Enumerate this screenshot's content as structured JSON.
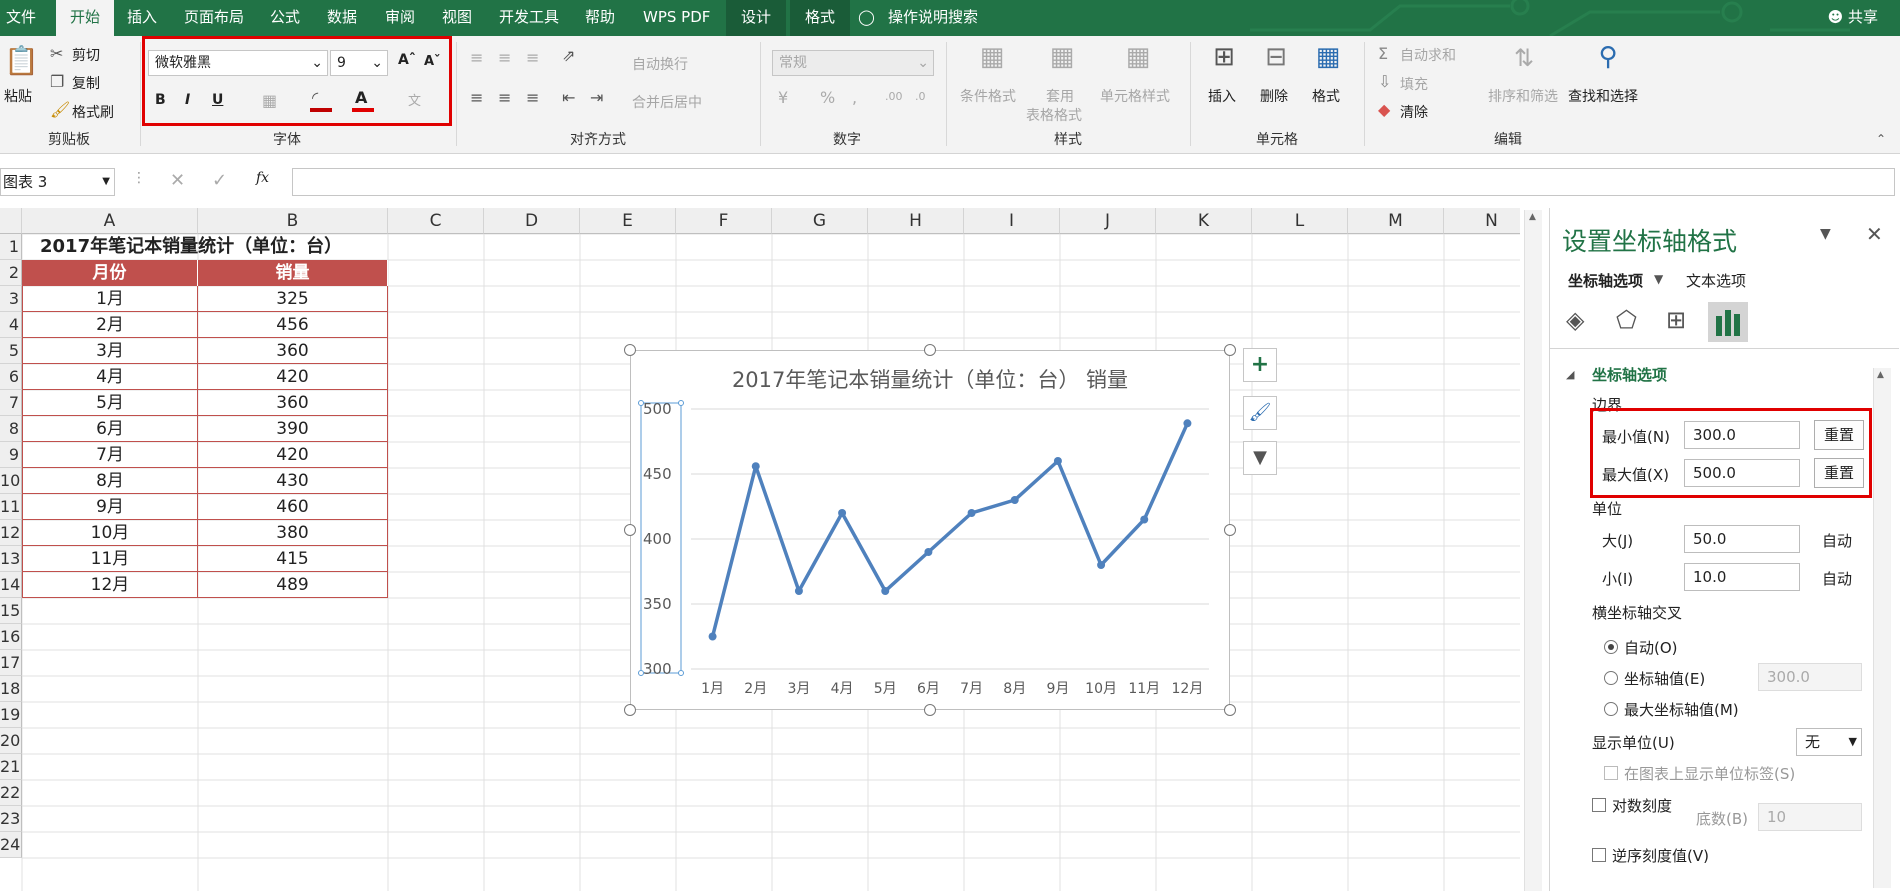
{
  "menu": {
    "tabs": [
      "文件",
      "开始",
      "插入",
      "页面布局",
      "公式",
      "数据",
      "审阅",
      "视图",
      "开发工具",
      "帮助",
      "WPS PDF",
      "设计",
      "格式"
    ],
    "active_tab": "开始",
    "search_label": "操作说明搜索",
    "share_label": "共享"
  },
  "ribbon": {
    "clipboard": {
      "paste": "粘贴",
      "cut": "剪切",
      "copy": "复制",
      "format_painter": "格式刷",
      "label": "剪贴板"
    },
    "font": {
      "family": "微软雅黑",
      "size": "9",
      "bold": "B",
      "italic": "I",
      "underline": "U",
      "label": "字体"
    },
    "alignment": {
      "wrap_text": "自动换行",
      "merge_center": "合并后居中",
      "label": "对齐方式"
    },
    "number": {
      "format": "常规",
      "label": "数字"
    },
    "styles": {
      "conditional": "条件格式",
      "table_line1": "套用",
      "table_line2": "表格格式",
      "cell_styles": "单元格样式",
      "label": "样式"
    },
    "cells": {
      "insert": "插入",
      "delete": "删除",
      "format": "格式",
      "label": "单元格"
    },
    "editing": {
      "autosum": "自动求和",
      "fill": "填充",
      "clear": "清除",
      "sort_filter": "排序和筛选",
      "find_select": "查找和选择",
      "label": "编辑"
    }
  },
  "formula_bar": {
    "name_box": "图表 3",
    "fx": "fx"
  },
  "sheet": {
    "columns": [
      "A",
      "B",
      "C",
      "D",
      "E",
      "F",
      "G",
      "H",
      "I",
      "J",
      "K",
      "L",
      "M",
      "N"
    ],
    "row_numbers": [
      "1",
      "2",
      "3",
      "4",
      "5",
      "6",
      "7",
      "8",
      "9",
      "10",
      "11",
      "12",
      "13",
      "14",
      "15",
      "16",
      "17",
      "18",
      "19",
      "20",
      "21",
      "22",
      "23",
      "24"
    ],
    "table_title": "2017年笔记本销量统计（单位：台）",
    "headers": [
      "月份",
      "销量"
    ],
    "rows": [
      [
        "1月",
        "325"
      ],
      [
        "2月",
        "456"
      ],
      [
        "3月",
        "360"
      ],
      [
        "4月",
        "420"
      ],
      [
        "5月",
        "360"
      ],
      [
        "6月",
        "390"
      ],
      [
        "7月",
        "420"
      ],
      [
        "8月",
        "430"
      ],
      [
        "9月",
        "460"
      ],
      [
        "10月",
        "380"
      ],
      [
        "11月",
        "415"
      ],
      [
        "12月",
        "489"
      ]
    ]
  },
  "chart_data": {
    "type": "line",
    "title": "2017年笔记本销量统计（单位：台） 销量",
    "categories": [
      "1月",
      "2月",
      "3月",
      "4月",
      "5月",
      "6月",
      "7月",
      "8月",
      "9月",
      "10月",
      "11月",
      "12月"
    ],
    "series": [
      {
        "values": [
          325,
          456,
          360,
          420,
          360,
          390,
          420,
          430,
          460,
          380,
          415,
          489
        ]
      }
    ],
    "ylim": [
      300,
      500
    ],
    "yticks": [
      "300",
      "350",
      "400",
      "450",
      "500"
    ],
    "line_color": "#4f81bd",
    "grid": true
  },
  "format_pane": {
    "title": "设置坐标轴格式",
    "tab_axis_options": "坐标轴选项",
    "tab_text_options": "文本选项",
    "section": "坐标轴选项",
    "bounds_label": "边界",
    "min_label": "最小值(N)",
    "min_value": "300.0",
    "max_label": "最大值(X)",
    "max_value": "500.0",
    "reset_label": "重置",
    "units_label": "单位",
    "major_label": "大(J)",
    "major_value": "50.0",
    "minor_label": "小(I)",
    "minor_value": "10.0",
    "auto_label": "自动",
    "cross_label": "横坐标轴交叉",
    "cross_auto": "自动(O)",
    "cross_value_label": "坐标轴值(E)",
    "cross_value": "300.0",
    "cross_max": "最大坐标轴值(M)",
    "display_units_label": "显示单位(U)",
    "display_units_value": "无",
    "show_units_label": "在图表上显示单位标签(S)",
    "log_scale_label": "对数刻度",
    "base_label": "底数(B)",
    "base_value": "10",
    "reverse_label": "逆序刻度值(V)"
  },
  "colors": {
    "excel_green": "#217346",
    "header_red": "#c0504d",
    "highlight": "#e00000"
  }
}
